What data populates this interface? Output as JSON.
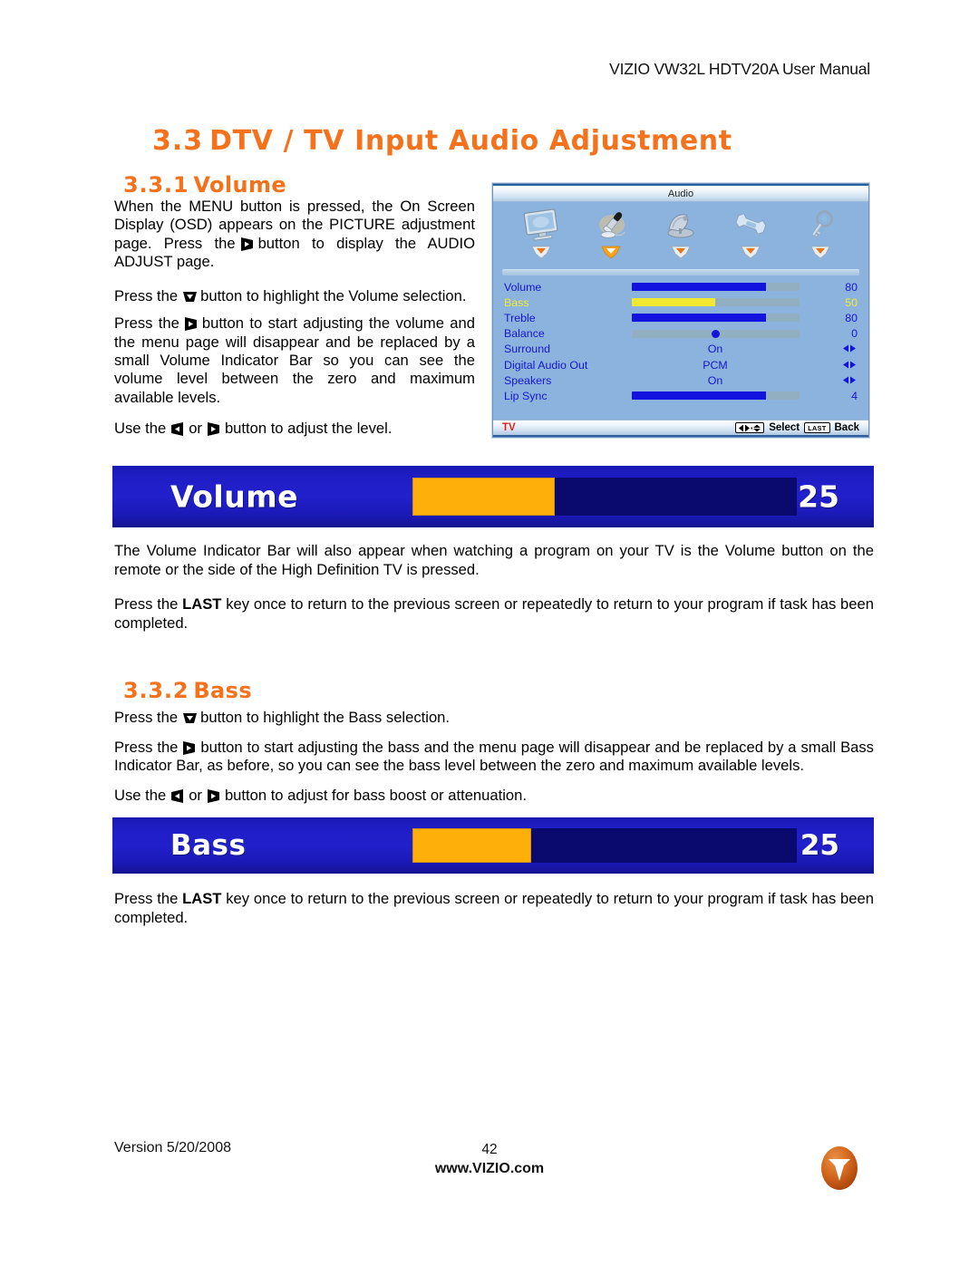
{
  "header": {
    "manual_title": "VIZIO VW32L HDTV20A User Manual"
  },
  "headings": {
    "section_number": "3.3",
    "section_title": "DTV / TV Input Audio Adjustment",
    "sub1_number": "3.3.1",
    "sub1_title": "Volume",
    "sub2_number": "3.3.2",
    "sub2_title": "Bass"
  },
  "volume_body": {
    "p1_a": "When the MENU button is pressed, the On Screen Display (OSD) appears on the PICTURE adjustment page.  Press the",
    "p1_icon": "right-arrow-button-icon",
    "p1_b": "button to display the AUDIO ADJUST page.",
    "p2_a": "Press the",
    "p2_icon": "down-arrow-button-icon",
    "p2_b": "button to highlight the Volume selection.",
    "p3_a": "Press the",
    "p3_icon": "right-arrow-button-icon",
    "p3_b": "button to start adjusting the volume and the menu page will disappear and be replaced by a small Volume Indicator Bar so you can see the volume level between the zero and maximum available levels.",
    "p4_a": "Use the",
    "p4_icon_left": "left-arrow-button-icon",
    "p4_or": "or",
    "p4_icon_right": "right-arrow-button-icon",
    "p4_b": "button to adjust the level."
  },
  "volume_notes": {
    "note1": "The Volume Indicator Bar will also appear when watching a program on your TV is the Volume button on the remote or the side of the High Definition TV is pressed.",
    "note2_a": "Press the",
    "note2_key": "LAST",
    "note2_b": "key once to return to the previous screen or repeatedly to return to your program if task has been completed."
  },
  "bass_body": {
    "p1_a": "Press the",
    "p1_icon": "down-arrow-button-icon",
    "p1_b": "button to highlight the Bass selection.",
    "p2_a": "Press the",
    "p2_icon": "right-arrow-button-icon",
    "p2_b": "button to start adjusting the bass and the menu page will disappear and be replaced by a small Bass Indicator Bar, as before, so you can see the bass level between the zero and maximum available levels.",
    "p3_a": "Use the",
    "p3_icon_left": "left-arrow-button-icon",
    "p3_or": "or",
    "p3_icon_right": "right-arrow-button-icon",
    "p3_b": "button to adjust for bass boost or attenuation."
  },
  "bass_notes": {
    "note1_a": "Press the",
    "note1_key": "LAST",
    "note1_b": "key once to return to the previous screen or repeatedly to return to your program if task has been completed."
  },
  "osd": {
    "title": "Audio",
    "tabs": [
      {
        "name": "picture",
        "icon": "monitor-icon",
        "selected": false
      },
      {
        "name": "audio",
        "icon": "microphone-icon",
        "selected": true
      },
      {
        "name": "tuner",
        "icon": "satellite-dish-icon",
        "selected": false
      },
      {
        "name": "setup",
        "icon": "wrench-icon",
        "selected": false
      },
      {
        "name": "parental",
        "icon": "key-icon",
        "selected": false
      }
    ],
    "rows": [
      {
        "label": "Volume",
        "type": "slider",
        "value": "80",
        "fill_pct": 80,
        "selected": false
      },
      {
        "label": "Bass",
        "type": "slider",
        "value": "50",
        "fill_pct": 50,
        "selected": true
      },
      {
        "label": "Treble",
        "type": "slider",
        "value": "80",
        "fill_pct": 80,
        "selected": false
      },
      {
        "label": "Balance",
        "type": "knob",
        "value": "0",
        "fill_pct": 50,
        "selected": false
      },
      {
        "label": "Surround",
        "type": "option",
        "value": "On",
        "selected": false
      },
      {
        "label": "Digital Audio Out",
        "type": "option",
        "value": "PCM",
        "selected": false
      },
      {
        "label": "Speakers",
        "type": "option",
        "value": "On",
        "selected": false
      },
      {
        "label": "Lip Sync",
        "type": "slider",
        "value": "4",
        "fill_pct": 80,
        "selected": false
      }
    ],
    "footer": {
      "source": "TV",
      "select_label": "Select",
      "last_key": "LAST",
      "back_label": "Back"
    }
  },
  "indicator_volume": {
    "label": "Volume",
    "value": "25",
    "fill_pct": 37
  },
  "indicator_bass": {
    "label": "Bass",
    "value": "25",
    "fill_pct": 31
  },
  "footer": {
    "version": "Version 5/20/2008",
    "page_number": "42",
    "website": "www.VIZIO.com",
    "logo": "vizio-v-logo"
  },
  "colors": {
    "accent_orange": "#F4721B",
    "osd_blue": "#8CB3DE",
    "osd_text_blue": "#1616C8",
    "osd_selected_yellow": "#F2E832",
    "bar_navy": "#1F1EC6",
    "bar_orange": "#FFAF0A",
    "source_red": "#E02020"
  }
}
